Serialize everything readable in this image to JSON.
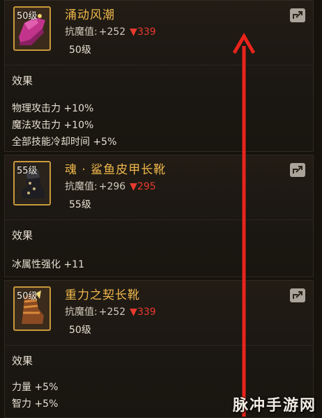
{
  "items": [
    {
      "level_badge": "50级",
      "name": "涌动风潮",
      "stat_label": "抗魔值:",
      "stat_base": "+252",
      "stat_down": "▼339",
      "level_text": "50级",
      "effect_title": "效果",
      "effects": [
        "物理攻击力 +10%",
        "魔法攻击力 +10%",
        "全部技能冷却时间 +5%"
      ],
      "icon": "pink-boot-icon"
    },
    {
      "level_badge": "55级",
      "name": "魂 · 鲨鱼皮甲长靴",
      "stat_label": "抗魔值:",
      "stat_base": "+296",
      "stat_down": "▼295",
      "level_text": "55级",
      "effect_title": "效果",
      "effects": [
        "冰属性强化 +11"
      ],
      "icon": "black-boot-icon"
    },
    {
      "level_badge": "50级",
      "name": "重力之契长靴",
      "stat_label": "抗魔值:",
      "stat_base": "+252",
      "stat_down": "▼339",
      "level_text": "50级",
      "effect_title": "效果",
      "effects": [
        "力量 +5%",
        "智力 +5%"
      ],
      "icon": "bronze-boot-icon"
    }
  ],
  "watermark": "脉冲手游网",
  "colors": {
    "name": "#f0b84c",
    "down": "#e83a2e",
    "arrow": "#e8241c",
    "border": "#c89a3a"
  }
}
